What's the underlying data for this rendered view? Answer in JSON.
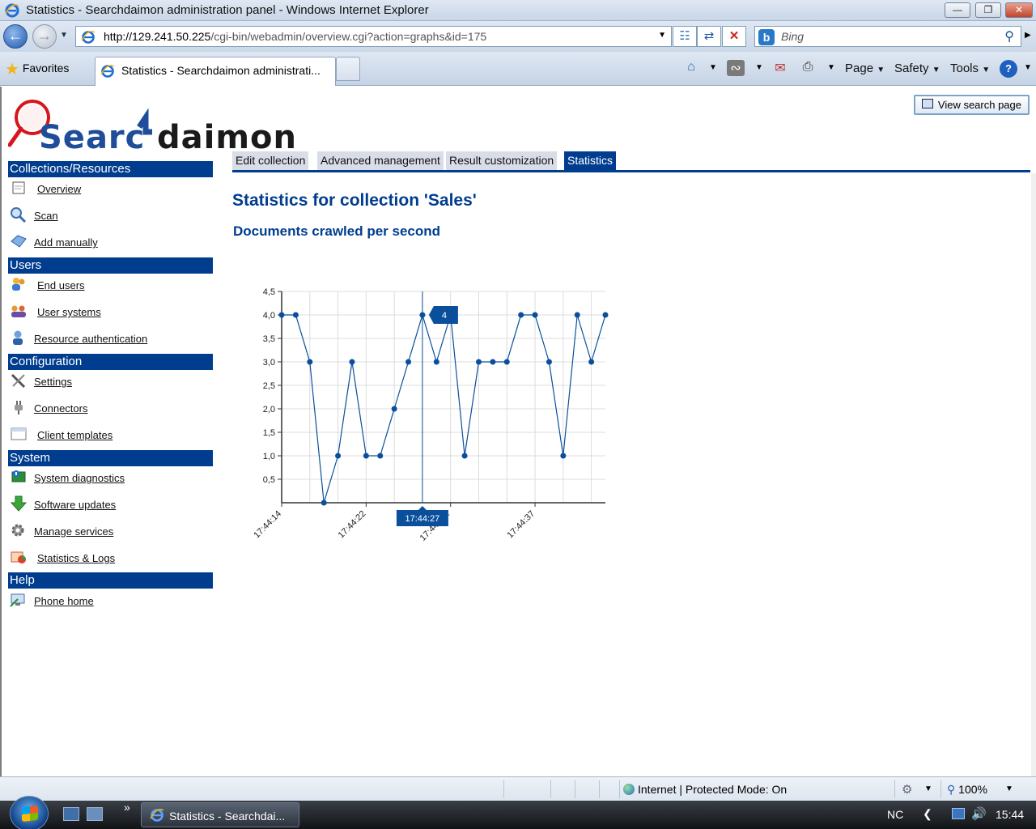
{
  "window": {
    "title": "Statistics - Searchdaimon administration panel - Windows Internet Explorer",
    "minimize_glyph": "—",
    "restore_glyph": "❐",
    "close_glyph": "✕"
  },
  "address": {
    "url_host": "http://129.241.50.225",
    "url_path": "/cgi-bin/webadmin/overview.cgi?action=graphs&id=175",
    "search_placeholder": "Bing"
  },
  "tabs": {
    "favorites_label": "Favorites",
    "active_tab_label": "Statistics - Searchdaimon administrati..."
  },
  "commandbar": {
    "page_label": "Page",
    "safety_label": "Safety",
    "tools_label": "Tools"
  },
  "header": {
    "view_search_label": "View search page"
  },
  "sidebar": {
    "sections": [
      {
        "title": "Collections/Resources",
        "items": [
          "Overview",
          "Scan",
          "Add manually"
        ]
      },
      {
        "title": "Users",
        "items": [
          "End users",
          "User systems",
          "Resource authentication"
        ]
      },
      {
        "title": "Configuration",
        "items": [
          "Settings",
          "Connectors",
          "Client templates"
        ]
      },
      {
        "title": "System",
        "items": [
          "System diagnostics",
          "Software updates",
          "Manage services",
          "Statistics & Logs"
        ]
      },
      {
        "title": "Help",
        "items": [
          "Phone home"
        ]
      }
    ]
  },
  "page_tabs": [
    "Edit collection",
    "Advanced management",
    "Result customization",
    "Statistics"
  ],
  "main": {
    "title": "Statistics for collection 'Sales'",
    "subtitle": "Documents crawled per second"
  },
  "chart_data": {
    "type": "line",
    "title": "",
    "xlabel": "",
    "ylabel": "",
    "x_tick_labels": [
      "17:44:14",
      "17:44:22",
      "17:44:2…",
      "17:44:37"
    ],
    "y_tick_labels": [
      "0,5",
      "1,0",
      "1,5",
      "2,0",
      "2,5",
      "3,0",
      "3,5",
      "4,0",
      "4,5"
    ],
    "ylim": [
      0,
      4.5
    ],
    "values": [
      4,
      4,
      3,
      0,
      1,
      3,
      1,
      1,
      2,
      3,
      4,
      3,
      4,
      1,
      3,
      3,
      3,
      4,
      4,
      3,
      1,
      4,
      3,
      4
    ],
    "tooltip_value": "4",
    "tooltip_x_label": "17:44:27",
    "tooltip_index": 10,
    "line_color": "#0a4f9c",
    "grid": true
  },
  "statusbar": {
    "zone": "Internet | Protected Mode: On",
    "zoom": "100%"
  },
  "taskbar": {
    "task_label": "Statistics - Searchdai...",
    "tray_lang": "NC",
    "clock": "15:44"
  }
}
